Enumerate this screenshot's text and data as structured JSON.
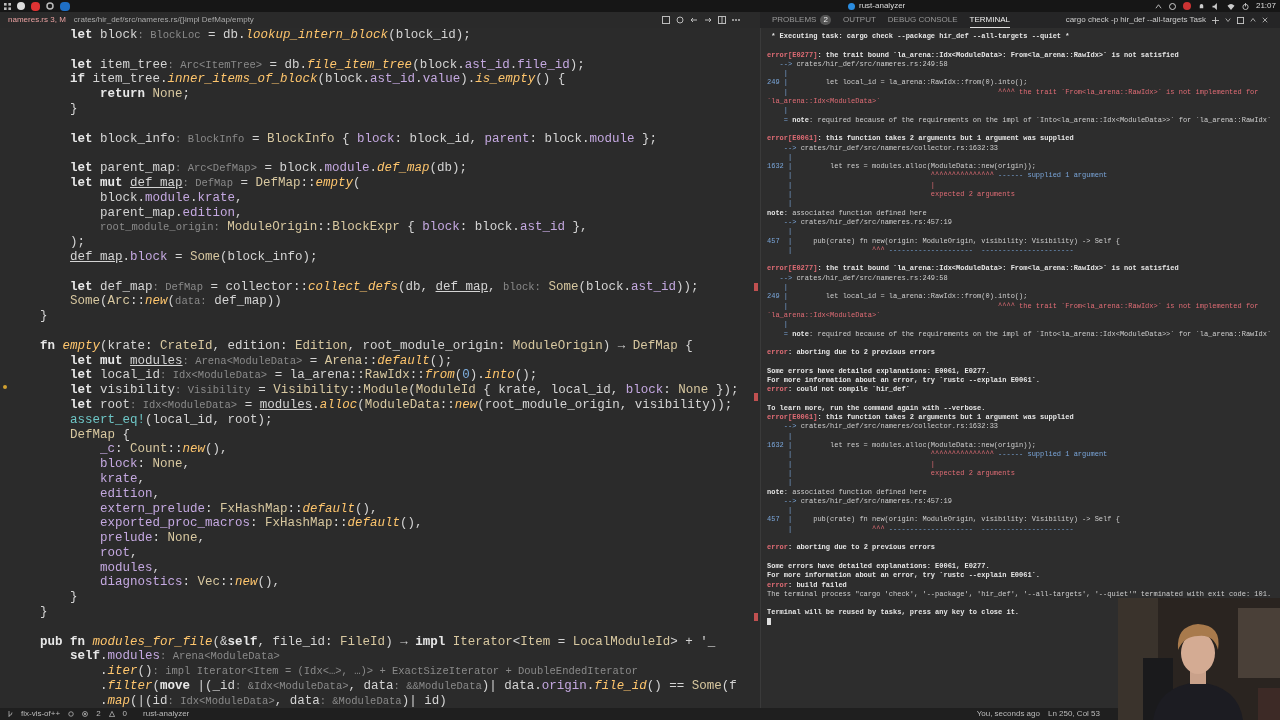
{
  "os_bar": {
    "title": "rust-analyzer",
    "clock": "21:07"
  },
  "editor": {
    "tab": "nameres.rs",
    "tab_badge": "3, M",
    "breadcrumb": "crates/hir_def/src/nameres.rs/{}impl DefMap/empty"
  },
  "panel": {
    "tabs": [
      {
        "label": "PROBLEMS",
        "badge": "2",
        "selected": false
      },
      {
        "label": "OUTPUT",
        "selected": false
      },
      {
        "label": "DEBUG CONSOLE",
        "selected": false
      },
      {
        "label": "TERMINAL",
        "selected": true
      }
    ],
    "task": "cargo check -p hir_def --all-targets Task"
  },
  "code": {
    "lines": [
      {
        "kind": "code",
        "tokens": [
          {
            "kind": "kw",
            "text": "        let "
          },
          {
            "kind": "id",
            "text": "block"
          },
          {
            "kind": "hint",
            "text": ": BlockLoc"
          },
          {
            "kind": "id",
            "text": " = db."
          },
          {
            "kind": "fn",
            "text": "lookup_intern_block"
          },
          {
            "kind": "id",
            "text": "(block_id);"
          }
        ]
      },
      {
        "kind": "blank"
      },
      {
        "kind": "code",
        "tokens": [
          {
            "kind": "kw",
            "text": "        let "
          },
          {
            "kind": "id",
            "text": "item_tree"
          },
          {
            "kind": "hint",
            "text": ": Arc<ItemTree>"
          },
          {
            "kind": "id",
            "text": " = db."
          },
          {
            "kind": "fn",
            "text": "file_item_tree"
          },
          {
            "kind": "id",
            "text": "(block."
          },
          {
            "kind": "field",
            "text": "ast_id"
          },
          {
            "kind": "id",
            "text": "."
          },
          {
            "kind": "field",
            "text": "file_id"
          },
          {
            "kind": "id",
            "text": ");"
          }
        ]
      },
      {
        "kind": "code",
        "tokens": [
          {
            "kind": "kw",
            "text": "        if "
          },
          {
            "kind": "id",
            "text": "item_tree."
          },
          {
            "kind": "fn",
            "text": "inner_items_of_block"
          },
          {
            "kind": "id",
            "text": "(block."
          },
          {
            "kind": "field",
            "text": "ast_id"
          },
          {
            "kind": "id",
            "text": "."
          },
          {
            "kind": "field",
            "text": "value"
          },
          {
            "kind": "id",
            "text": ")."
          },
          {
            "kind": "fn",
            "text": "is_empty"
          },
          {
            "kind": "id",
            "text": "() {"
          }
        ]
      },
      {
        "kind": "code",
        "tokens": [
          {
            "kind": "kw",
            "text": "            return "
          },
          {
            "kind": "ty",
            "text": "None"
          },
          {
            "kind": "id",
            "text": ";"
          }
        ]
      },
      {
        "kind": "code",
        "tokens": [
          {
            "kind": "id",
            "text": "        }"
          }
        ]
      },
      {
        "kind": "blank"
      },
      {
        "kind": "code",
        "tokens": [
          {
            "kind": "kw",
            "text": "        let "
          },
          {
            "kind": "id",
            "text": "block_info"
          },
          {
            "kind": "hint",
            "text": ": BlockInfo"
          },
          {
            "kind": "id",
            "text": " = "
          },
          {
            "kind": "ty",
            "text": "BlockInfo"
          },
          {
            "kind": "id",
            "text": " { "
          },
          {
            "kind": "field",
            "text": "block"
          },
          {
            "kind": "id",
            "text": ": block_id, "
          },
          {
            "kind": "field",
            "text": "parent"
          },
          {
            "kind": "id",
            "text": ": block."
          },
          {
            "kind": "field",
            "text": "module"
          },
          {
            "kind": "id",
            "text": " };"
          }
        ]
      },
      {
        "kind": "blank"
      },
      {
        "kind": "code",
        "tokens": [
          {
            "kind": "kw",
            "text": "        let "
          },
          {
            "kind": "id",
            "text": "parent_map"
          },
          {
            "kind": "hint",
            "text": ": Arc<DefMap>"
          },
          {
            "kind": "id",
            "text": " = block."
          },
          {
            "kind": "field",
            "text": "module"
          },
          {
            "kind": "id",
            "text": "."
          },
          {
            "kind": "fn",
            "text": "def_map"
          },
          {
            "kind": "id",
            "text": "(db);"
          }
        ]
      },
      {
        "kind": "code",
        "tokens": [
          {
            "kind": "kw",
            "text": "        let mut "
          },
          {
            "kind": "mut",
            "text": "def_map"
          },
          {
            "kind": "hint",
            "text": ": DefMap"
          },
          {
            "kind": "id",
            "text": " = "
          },
          {
            "kind": "ty",
            "text": "DefMap"
          },
          {
            "kind": "id",
            "text": "::"
          },
          {
            "kind": "fn",
            "text": "empty"
          },
          {
            "kind": "id",
            "text": "("
          }
        ]
      },
      {
        "kind": "code",
        "tokens": [
          {
            "kind": "id",
            "text": "            block."
          },
          {
            "kind": "field",
            "text": "module"
          },
          {
            "kind": "id",
            "text": "."
          },
          {
            "kind": "field",
            "text": "krate"
          },
          {
            "kind": "id",
            "text": ","
          }
        ]
      },
      {
        "kind": "code",
        "tokens": [
          {
            "kind": "id",
            "text": "            parent_map."
          },
          {
            "kind": "field",
            "text": "edition"
          },
          {
            "kind": "id",
            "text": ","
          }
        ]
      },
      {
        "kind": "code",
        "tokens": [
          {
            "kind": "hint",
            "text": "            root_module_origin:"
          },
          {
            "kind": "ty",
            "text": " ModuleOrigin"
          },
          {
            "kind": "id",
            "text": "::"
          },
          {
            "kind": "ty",
            "text": "BlockExpr"
          },
          {
            "kind": "id",
            "text": " { "
          },
          {
            "kind": "field",
            "text": "block"
          },
          {
            "kind": "id",
            "text": ": block."
          },
          {
            "kind": "field",
            "text": "ast_id"
          },
          {
            "kind": "id",
            "text": " },"
          }
        ]
      },
      {
        "kind": "code",
        "tokens": [
          {
            "kind": "id",
            "text": "        );"
          }
        ]
      },
      {
        "kind": "code",
        "tokens": [
          {
            "kind": "mut",
            "text": "        def_map"
          },
          {
            "kind": "id",
            "text": "."
          },
          {
            "kind": "field",
            "text": "block"
          },
          {
            "kind": "id",
            "text": " = "
          },
          {
            "kind": "ty",
            "text": "Some"
          },
          {
            "kind": "id",
            "text": "(block_info);"
          }
        ]
      },
      {
        "kind": "blank"
      },
      {
        "kind": "code",
        "tokens": [
          {
            "kind": "kw",
            "text": "        let "
          },
          {
            "kind": "id",
            "text": "def_map"
          },
          {
            "kind": "hint",
            "text": ": DefMap"
          },
          {
            "kind": "id",
            "text": " = collector::"
          },
          {
            "kind": "fn",
            "text": "collect_defs"
          },
          {
            "kind": "id",
            "text": "(db, "
          },
          {
            "kind": "mut",
            "text": "def_map"
          },
          {
            "kind": "id",
            "text": ", "
          },
          {
            "kind": "hint",
            "text": "block:"
          },
          {
            "kind": "ty",
            "text": " Some"
          },
          {
            "kind": "id",
            "text": "(block."
          },
          {
            "kind": "field",
            "text": "ast_id"
          },
          {
            "kind": "id",
            "text": "));"
          }
        ]
      },
      {
        "kind": "code",
        "tokens": [
          {
            "kind": "ty",
            "text": "        Some"
          },
          {
            "kind": "id",
            "text": "("
          },
          {
            "kind": "ty",
            "text": "Arc"
          },
          {
            "kind": "id",
            "text": "::"
          },
          {
            "kind": "fn",
            "text": "new"
          },
          {
            "kind": "id",
            "text": "("
          },
          {
            "kind": "hint",
            "text": "data:"
          },
          {
            "kind": "id",
            "text": " def_map))"
          }
        ]
      },
      {
        "kind": "code",
        "tokens": [
          {
            "kind": "id",
            "text": "    }"
          }
        ]
      },
      {
        "kind": "blank"
      },
      {
        "kind": "code",
        "tokens": [
          {
            "kind": "kw",
            "text": "    fn "
          },
          {
            "kind": "fn",
            "text": "empty"
          },
          {
            "kind": "id",
            "text": "(krate: "
          },
          {
            "kind": "ty",
            "text": "CrateId"
          },
          {
            "kind": "id",
            "text": ", edition: "
          },
          {
            "kind": "ty",
            "text": "Edition"
          },
          {
            "kind": "id",
            "text": ", root_module_origin: "
          },
          {
            "kind": "ty",
            "text": "ModuleOrigin"
          },
          {
            "kind": "id",
            "text": ") → "
          },
          {
            "kind": "ty",
            "text": "DefMap"
          },
          {
            "kind": "id",
            "text": " {"
          }
        ]
      },
      {
        "kind": "code",
        "tokens": [
          {
            "kind": "kw",
            "text": "        let mut "
          },
          {
            "kind": "mut",
            "text": "modules"
          },
          {
            "kind": "hint",
            "text": ": Arena<ModuleData>"
          },
          {
            "kind": "id",
            "text": " = "
          },
          {
            "kind": "ty",
            "text": "Arena"
          },
          {
            "kind": "id",
            "text": "::"
          },
          {
            "kind": "fn",
            "text": "default"
          },
          {
            "kind": "id",
            "text": "();"
          }
        ]
      },
      {
        "kind": "code",
        "tokens": [
          {
            "kind": "kw",
            "text": "        let "
          },
          {
            "kind": "id",
            "text": "local_id"
          },
          {
            "kind": "hint",
            "text": ": Idx<ModuleData>"
          },
          {
            "kind": "id",
            "text": " = la_arena::"
          },
          {
            "kind": "ty",
            "text": "RawIdx"
          },
          {
            "kind": "id",
            "text": "::"
          },
          {
            "kind": "fn",
            "text": "from"
          },
          {
            "kind": "id",
            "text": "("
          },
          {
            "kind": "num",
            "text": "0"
          },
          {
            "kind": "id",
            "text": ")."
          },
          {
            "kind": "fn",
            "text": "into"
          },
          {
            "kind": "id",
            "text": "();"
          }
        ]
      },
      {
        "kind": "code",
        "tokens": [
          {
            "kind": "kw",
            "text": "        let "
          },
          {
            "kind": "id",
            "text": "visibility"
          },
          {
            "kind": "hint",
            "text": ": Visibility"
          },
          {
            "kind": "id",
            "text": " = "
          },
          {
            "kind": "ty",
            "text": "Visibility"
          },
          {
            "kind": "id",
            "text": "::"
          },
          {
            "kind": "ty",
            "text": "Module"
          },
          {
            "kind": "id",
            "text": "("
          },
          {
            "kind": "ty",
            "text": "ModuleId"
          },
          {
            "kind": "id",
            "text": " { krate, local_id, "
          },
          {
            "kind": "field",
            "text": "block"
          },
          {
            "kind": "id",
            "text": ": "
          },
          {
            "kind": "ty",
            "text": "None"
          },
          {
            "kind": "id",
            "text": " });"
          }
        ]
      },
      {
        "kind": "code",
        "tokens": [
          {
            "kind": "kw",
            "text": "        let "
          },
          {
            "kind": "id",
            "text": "root"
          },
          {
            "kind": "hint",
            "text": ": Idx<ModuleData>"
          },
          {
            "kind": "id",
            "text": " = "
          },
          {
            "kind": "mut",
            "text": "modules"
          },
          {
            "kind": "id",
            "text": "."
          },
          {
            "kind": "fn",
            "text": "alloc"
          },
          {
            "kind": "id",
            "text": "("
          },
          {
            "kind": "ty",
            "text": "ModuleData"
          },
          {
            "kind": "id",
            "text": "::"
          },
          {
            "kind": "fn",
            "text": "new"
          },
          {
            "kind": "id",
            "text": "(root_module_origin, visibility));"
          }
        ]
      },
      {
        "kind": "code",
        "tokens": [
          {
            "kind": "macro",
            "text": "        assert_eq!"
          },
          {
            "kind": "id",
            "text": "(local_id, root);"
          }
        ]
      },
      {
        "kind": "code",
        "tokens": [
          {
            "kind": "ty",
            "text": "        DefMap"
          },
          {
            "kind": "id",
            "text": " {"
          }
        ]
      },
      {
        "kind": "code",
        "tokens": [
          {
            "kind": "field",
            "text": "            _c"
          },
          {
            "kind": "id",
            "text": ": "
          },
          {
            "kind": "ty",
            "text": "Count"
          },
          {
            "kind": "id",
            "text": "::"
          },
          {
            "kind": "fn",
            "text": "new"
          },
          {
            "kind": "id",
            "text": "(),"
          }
        ]
      },
      {
        "kind": "code",
        "tokens": [
          {
            "kind": "field",
            "text": "            block"
          },
          {
            "kind": "id",
            "text": ": "
          },
          {
            "kind": "ty",
            "text": "None"
          },
          {
            "kind": "id",
            "text": ","
          }
        ]
      },
      {
        "kind": "code",
        "tokens": [
          {
            "kind": "field",
            "text": "            krate"
          },
          {
            "kind": "id",
            "text": ","
          }
        ]
      },
      {
        "kind": "code",
        "tokens": [
          {
            "kind": "field",
            "text": "            edition"
          },
          {
            "kind": "id",
            "text": ","
          }
        ]
      },
      {
        "kind": "code",
        "tokens": [
          {
            "kind": "field",
            "text": "            extern_prelude"
          },
          {
            "kind": "id",
            "text": ": "
          },
          {
            "kind": "ty",
            "text": "FxHashMap"
          },
          {
            "kind": "id",
            "text": "::"
          },
          {
            "kind": "fn",
            "text": "default"
          },
          {
            "kind": "id",
            "text": "(),"
          }
        ]
      },
      {
        "kind": "code",
        "tokens": [
          {
            "kind": "field",
            "text": "            exported_proc_macros"
          },
          {
            "kind": "id",
            "text": ": "
          },
          {
            "kind": "ty",
            "text": "FxHashMap"
          },
          {
            "kind": "id",
            "text": "::"
          },
          {
            "kind": "fn",
            "text": "default"
          },
          {
            "kind": "id",
            "text": "(),"
          }
        ]
      },
      {
        "kind": "code",
        "tokens": [
          {
            "kind": "field",
            "text": "            prelude"
          },
          {
            "kind": "id",
            "text": ": "
          },
          {
            "kind": "ty",
            "text": "None"
          },
          {
            "kind": "id",
            "text": ","
          }
        ]
      },
      {
        "kind": "code",
        "tokens": [
          {
            "kind": "field",
            "text": "            root"
          },
          {
            "kind": "id",
            "text": ","
          }
        ]
      },
      {
        "kind": "code",
        "tokens": [
          {
            "kind": "field",
            "text": "            modules"
          },
          {
            "kind": "id",
            "text": ","
          }
        ]
      },
      {
        "kind": "code",
        "tokens": [
          {
            "kind": "field",
            "text": "            diagnostics"
          },
          {
            "kind": "id",
            "text": ": "
          },
          {
            "kind": "ty",
            "text": "Vec"
          },
          {
            "kind": "id",
            "text": "::"
          },
          {
            "kind": "fn",
            "text": "new"
          },
          {
            "kind": "id",
            "text": "(),"
          }
        ]
      },
      {
        "kind": "code",
        "tokens": [
          {
            "kind": "id",
            "text": "        }"
          }
        ]
      },
      {
        "kind": "code",
        "tokens": [
          {
            "kind": "id",
            "text": "    }"
          }
        ]
      },
      {
        "kind": "blank"
      },
      {
        "kind": "code",
        "tokens": [
          {
            "kind": "kw",
            "text": "    pub fn "
          },
          {
            "kind": "fn",
            "text": "modules_for_file"
          },
          {
            "kind": "id",
            "text": "(&"
          },
          {
            "kind": "kw",
            "text": "self"
          },
          {
            "kind": "id",
            "text": ", file_id: "
          },
          {
            "kind": "ty",
            "text": "FileId"
          },
          {
            "kind": "id",
            "text": ") → "
          },
          {
            "kind": "kw",
            "text": "impl "
          },
          {
            "kind": "ty",
            "text": "Iterator"
          },
          {
            "kind": "id",
            "text": "<"
          },
          {
            "kind": "ty",
            "text": "Item"
          },
          {
            "kind": "id",
            "text": " = "
          },
          {
            "kind": "ty",
            "text": "LocalModuleId"
          },
          {
            "kind": "id",
            "text": "> + '_"
          }
        ]
      },
      {
        "kind": "code",
        "tokens": [
          {
            "kind": "kw",
            "text": "        self"
          },
          {
            "kind": "id",
            "text": "."
          },
          {
            "kind": "field",
            "text": "modules"
          },
          {
            "kind": "hint",
            "text": ": Arena<ModuleData>"
          }
        ]
      },
      {
        "kind": "code",
        "tokens": [
          {
            "kind": "id",
            "text": "            ."
          },
          {
            "kind": "fn",
            "text": "iter"
          },
          {
            "kind": "id",
            "text": "()"
          },
          {
            "kind": "hint",
            "text": ": impl Iterator<Item = (Idx<…>, …)> + ExactSizeIterator + DoubleEndedIterator"
          }
        ]
      },
      {
        "kind": "code",
        "tokens": [
          {
            "kind": "id",
            "text": "            ."
          },
          {
            "kind": "fn",
            "text": "filter"
          },
          {
            "kind": "id",
            "text": "("
          },
          {
            "kind": "kw",
            "text": "move "
          },
          {
            "kind": "id",
            "text": "|(_id"
          },
          {
            "kind": "hint",
            "text": ": &Idx<ModuleData>"
          },
          {
            "kind": "id",
            "text": ", data"
          },
          {
            "kind": "hint",
            "text": ": &&ModuleData"
          },
          {
            "kind": "id",
            "text": ")| data."
          },
          {
            "kind": "field",
            "text": "origin"
          },
          {
            "kind": "id",
            "text": "."
          },
          {
            "kind": "fn",
            "text": "file_id"
          },
          {
            "kind": "id",
            "text": "() == "
          },
          {
            "kind": "ty",
            "text": "Some"
          },
          {
            "kind": "id",
            "text": "(f"
          }
        ]
      },
      {
        "kind": "code",
        "tokens": [
          {
            "kind": "id",
            "text": "            ."
          },
          {
            "kind": "fn",
            "text": "map"
          },
          {
            "kind": "id",
            "text": "(|(id"
          },
          {
            "kind": "hint",
            "text": ": Idx<ModuleData>"
          },
          {
            "kind": "id",
            "text": ", data"
          },
          {
            "kind": "hint",
            "text": ": &ModuleData"
          },
          {
            "kind": "id",
            "text": ")| id)"
          }
        ]
      }
    ]
  },
  "terminal": {
    "lines": [
      {
        "kind": "text",
        "tokens": [
          {
            "kind": "bold",
            "text": " * Executing task: cargo check --package hir_def --all-targets --quiet * "
          }
        ]
      },
      {
        "kind": "blank"
      },
      {
        "kind": "text",
        "tokens": [
          {
            "kind": "err",
            "text": "error[E0277]"
          },
          {
            "kind": "bold",
            "text": ": the trait bound `la_arena::Idx<ModuleData>: From<la_arena::RawIdx>` is not satisfied"
          }
        ]
      },
      {
        "kind": "text",
        "tokens": [
          {
            "kind": "gutter",
            "text": "   --> "
          },
          {
            "kind": "plain",
            "text": "crates/hir_def/src/nameres.rs:249:58"
          }
        ]
      },
      {
        "kind": "text",
        "tokens": [
          {
            "kind": "gutter",
            "text": "    |"
          }
        ]
      },
      {
        "kind": "text",
        "tokens": [
          {
            "kind": "gutter",
            "text": "249 | "
          },
          {
            "kind": "plain",
            "text": "        let local_id = la_arena::RawIdx::from(0).into();"
          }
        ]
      },
      {
        "kind": "text",
        "tokens": [
          {
            "kind": "gutter",
            "text": "    | "
          },
          {
            "kind": "label",
            "text": "                                                 ^^^^ the trait `From<la_arena::RawIdx>` is not implemented for `la_arena::Idx<ModuleData>`"
          }
        ]
      },
      {
        "kind": "text",
        "tokens": [
          {
            "kind": "gutter",
            "text": "    |"
          }
        ]
      },
      {
        "kind": "text",
        "tokens": [
          {
            "kind": "gutter",
            "text": "    = "
          },
          {
            "kind": "bold",
            "text": "note"
          },
          {
            "kind": "plain",
            "text": ": required because of the requirements on the impl of `Into<la_arena::Idx<ModuleData>>` for `la_arena::RawIdx`"
          }
        ]
      },
      {
        "kind": "blank"
      },
      {
        "kind": "text",
        "tokens": [
          {
            "kind": "err",
            "text": "error[E0061]"
          },
          {
            "kind": "bold",
            "text": ": this function takes 2 arguments but 1 argument was supplied"
          }
        ]
      },
      {
        "kind": "text",
        "tokens": [
          {
            "kind": "gutter",
            "text": "    --> "
          },
          {
            "kind": "plain",
            "text": "crates/hir_def/src/nameres/collector.rs:1632:33"
          }
        ]
      },
      {
        "kind": "text",
        "tokens": [
          {
            "kind": "gutter",
            "text": "     |"
          }
        ]
      },
      {
        "kind": "text",
        "tokens": [
          {
            "kind": "gutter",
            "text": "1632 | "
          },
          {
            "kind": "plain",
            "text": "        let res = modules.alloc(ModuleData::new(origin));"
          }
        ]
      },
      {
        "kind": "text",
        "tokens": [
          {
            "kind": "gutter",
            "text": "     | "
          },
          {
            "kind": "label",
            "text": "                                ^^^^^^^^^^^^^^^"
          },
          {
            "kind": "info",
            "text": " ------ supplied 1 argument"
          }
        ]
      },
      {
        "kind": "text",
        "tokens": [
          {
            "kind": "gutter",
            "text": "     | "
          },
          {
            "kind": "label",
            "text": "                                |"
          }
        ]
      },
      {
        "kind": "text",
        "tokens": [
          {
            "kind": "gutter",
            "text": "     | "
          },
          {
            "kind": "label",
            "text": "                                expected 2 arguments"
          }
        ]
      },
      {
        "kind": "text",
        "tokens": [
          {
            "kind": "gutter",
            "text": "     |"
          }
        ]
      },
      {
        "kind": "text",
        "tokens": [
          {
            "kind": "bold",
            "text": "note"
          },
          {
            "kind": "plain",
            "text": ": associated function defined here"
          }
        ]
      },
      {
        "kind": "text",
        "tokens": [
          {
            "kind": "gutter",
            "text": "    --> "
          },
          {
            "kind": "plain",
            "text": "crates/hir_def/src/nameres.rs:457:19"
          }
        ]
      },
      {
        "kind": "text",
        "tokens": [
          {
            "kind": "gutter",
            "text": "     |"
          }
        ]
      },
      {
        "kind": "text",
        "tokens": [
          {
            "kind": "gutter",
            "text": "457  | "
          },
          {
            "kind": "plain",
            "text": "    pub(crate) fn new(origin: ModuleOrigin, visibility: Visibility) -> Self {"
          }
        ]
      },
      {
        "kind": "text",
        "tokens": [
          {
            "kind": "gutter",
            "text": "     | "
          },
          {
            "kind": "label",
            "text": "                  ^^^"
          },
          {
            "kind": "info",
            "text": " --------------------  ----------------------"
          }
        ]
      },
      {
        "kind": "blank"
      },
      {
        "kind": "text",
        "tokens": [
          {
            "kind": "err",
            "text": "error[E0277]"
          },
          {
            "kind": "bold",
            "text": ": the trait bound `la_arena::Idx<ModuleData>: From<la_arena::RawIdx>` is not satisfied"
          }
        ]
      },
      {
        "kind": "text",
        "tokens": [
          {
            "kind": "gutter",
            "text": "   --> "
          },
          {
            "kind": "plain",
            "text": "crates/hir_def/src/nameres.rs:249:58"
          }
        ]
      },
      {
        "kind": "text",
        "tokens": [
          {
            "kind": "gutter",
            "text": "    |"
          }
        ]
      },
      {
        "kind": "text",
        "tokens": [
          {
            "kind": "gutter",
            "text": "249 | "
          },
          {
            "kind": "plain",
            "text": "        let local_id = la_arena::RawIdx::from(0).into();"
          }
        ]
      },
      {
        "kind": "text",
        "tokens": [
          {
            "kind": "gutter",
            "text": "    | "
          },
          {
            "kind": "label",
            "text": "                                                 ^^^^ the trait `From<la_arena::RawIdx>` is not implemented for `la_arena::Idx<ModuleData>`"
          }
        ]
      },
      {
        "kind": "text",
        "tokens": [
          {
            "kind": "gutter",
            "text": "    |"
          }
        ]
      },
      {
        "kind": "text",
        "tokens": [
          {
            "kind": "gutter",
            "text": "    = "
          },
          {
            "kind": "bold",
            "text": "note"
          },
          {
            "kind": "plain",
            "text": ": required because of the requirements on the impl of `Into<la_arena::Idx<ModuleData>>` for `la_arena::RawIdx`"
          }
        ]
      },
      {
        "kind": "blank"
      },
      {
        "kind": "text",
        "tokens": [
          {
            "kind": "err",
            "text": "error"
          },
          {
            "kind": "bold",
            "text": ": aborting due to 2 previous errors"
          }
        ]
      },
      {
        "kind": "blank"
      },
      {
        "kind": "text",
        "tokens": [
          {
            "kind": "bold",
            "text": "Some errors have detailed explanations: E0061, E0277."
          }
        ]
      },
      {
        "kind": "text",
        "tokens": [
          {
            "kind": "bold",
            "text": "For more information about an error, try `rustc --explain E0061`."
          }
        ]
      },
      {
        "kind": "text",
        "tokens": [
          {
            "kind": "err",
            "text": "error"
          },
          {
            "kind": "bold",
            "text": ": could not compile `hir_def`"
          }
        ]
      },
      {
        "kind": "blank"
      },
      {
        "kind": "text",
        "tokens": [
          {
            "kind": "bold",
            "text": "To learn more, run the command again with --verbose."
          }
        ]
      },
      {
        "kind": "text",
        "tokens": [
          {
            "kind": "err",
            "text": "error[E0061]"
          },
          {
            "kind": "bold",
            "text": ": this function takes 2 arguments but 1 argument was supplied"
          }
        ]
      },
      {
        "kind": "text",
        "tokens": [
          {
            "kind": "gutter",
            "text": "    --> "
          },
          {
            "kind": "plain",
            "text": "crates/hir_def/src/nameres/collector.rs:1632:33"
          }
        ]
      },
      {
        "kind": "text",
        "tokens": [
          {
            "kind": "gutter",
            "text": "     |"
          }
        ]
      },
      {
        "kind": "text",
        "tokens": [
          {
            "kind": "gutter",
            "text": "1632 | "
          },
          {
            "kind": "plain",
            "text": "        let res = modules.alloc(ModuleData::new(origin));"
          }
        ]
      },
      {
        "kind": "text",
        "tokens": [
          {
            "kind": "gutter",
            "text": "     | "
          },
          {
            "kind": "label",
            "text": "                                ^^^^^^^^^^^^^^^"
          },
          {
            "kind": "info",
            "text": " ------ supplied 1 argument"
          }
        ]
      },
      {
        "kind": "text",
        "tokens": [
          {
            "kind": "gutter",
            "text": "     | "
          },
          {
            "kind": "label",
            "text": "                                |"
          }
        ]
      },
      {
        "kind": "text",
        "tokens": [
          {
            "kind": "gutter",
            "text": "     | "
          },
          {
            "kind": "label",
            "text": "                                expected 2 arguments"
          }
        ]
      },
      {
        "kind": "text",
        "tokens": [
          {
            "kind": "gutter",
            "text": "     |"
          }
        ]
      },
      {
        "kind": "text",
        "tokens": [
          {
            "kind": "bold",
            "text": "note"
          },
          {
            "kind": "plain",
            "text": ": associated function defined here"
          }
        ]
      },
      {
        "kind": "text",
        "tokens": [
          {
            "kind": "gutter",
            "text": "    --> "
          },
          {
            "kind": "plain",
            "text": "crates/hir_def/src/nameres.rs:457:19"
          }
        ]
      },
      {
        "kind": "text",
        "tokens": [
          {
            "kind": "gutter",
            "text": "     |"
          }
        ]
      },
      {
        "kind": "text",
        "tokens": [
          {
            "kind": "gutter",
            "text": "457  | "
          },
          {
            "kind": "plain",
            "text": "    pub(crate) fn new(origin: ModuleOrigin, visibility: Visibility) -> Self {"
          }
        ]
      },
      {
        "kind": "text",
        "tokens": [
          {
            "kind": "gutter",
            "text": "     | "
          },
          {
            "kind": "label",
            "text": "                  ^^^"
          },
          {
            "kind": "info",
            "text": " --------------------  ----------------------"
          }
        ]
      },
      {
        "kind": "blank"
      },
      {
        "kind": "text",
        "tokens": [
          {
            "kind": "err",
            "text": "error"
          },
          {
            "kind": "bold",
            "text": ": aborting due to 2 previous errors"
          }
        ]
      },
      {
        "kind": "blank"
      },
      {
        "kind": "text",
        "tokens": [
          {
            "kind": "bold",
            "text": "Some errors have detailed explanations: E0061, E0277."
          }
        ]
      },
      {
        "kind": "text",
        "tokens": [
          {
            "kind": "bold",
            "text": "For more information about an error, try `rustc --explain E0061`."
          }
        ]
      },
      {
        "kind": "text",
        "tokens": [
          {
            "kind": "err",
            "text": "error"
          },
          {
            "kind": "bold",
            "text": ": build failed"
          }
        ]
      },
      {
        "kind": "text",
        "tokens": [
          {
            "kind": "plain",
            "text": "The terminal process \"cargo 'check', '--package', 'hir_def', '--all-targets', '--quiet'\" terminated with exit code: 101."
          }
        ]
      },
      {
        "kind": "blank"
      },
      {
        "kind": "text",
        "tokens": [
          {
            "kind": "bold",
            "text": "Terminal will be reused by tasks, press any key to close it."
          }
        ]
      }
    ]
  },
  "status_bar": {
    "branch": "fix-vis-of++",
    "errors": "2",
    "warnings": "0",
    "server": "rust-analyzer",
    "blame": "You, seconds ago",
    "position": "Ln 250, Col 53"
  }
}
